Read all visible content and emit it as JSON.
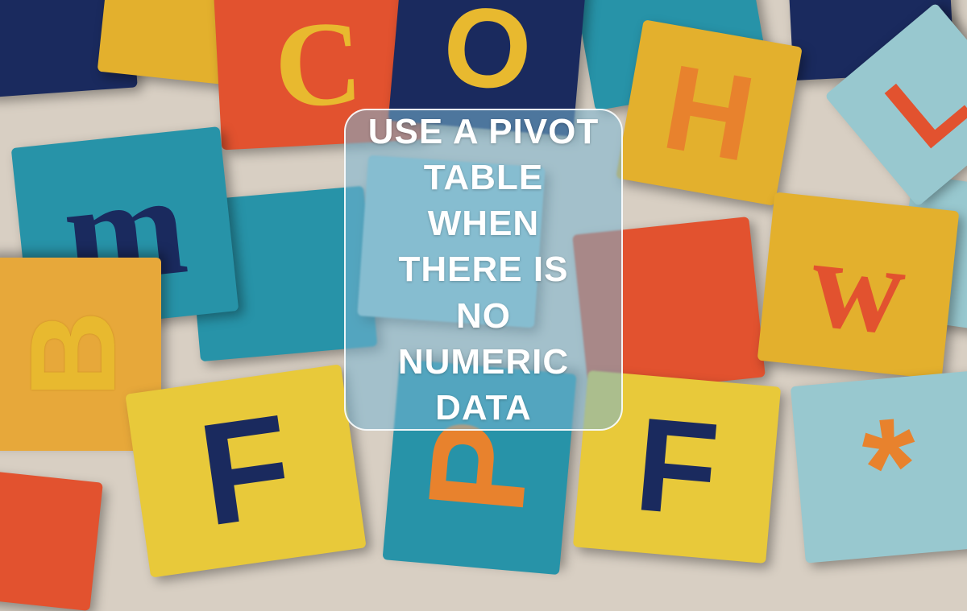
{
  "overlay": {
    "text": "USE A PIVOT TABLE WHEN THERE IS NO NUMERIC DATA"
  },
  "tiles": {
    "t3": "C",
    "t4": "O",
    "t6": "H",
    "t8": "L",
    "t9": "m",
    "t10": "B",
    "t14": "w",
    "t15": "F",
    "t16": "P",
    "t17": "F",
    "t18": "*"
  }
}
